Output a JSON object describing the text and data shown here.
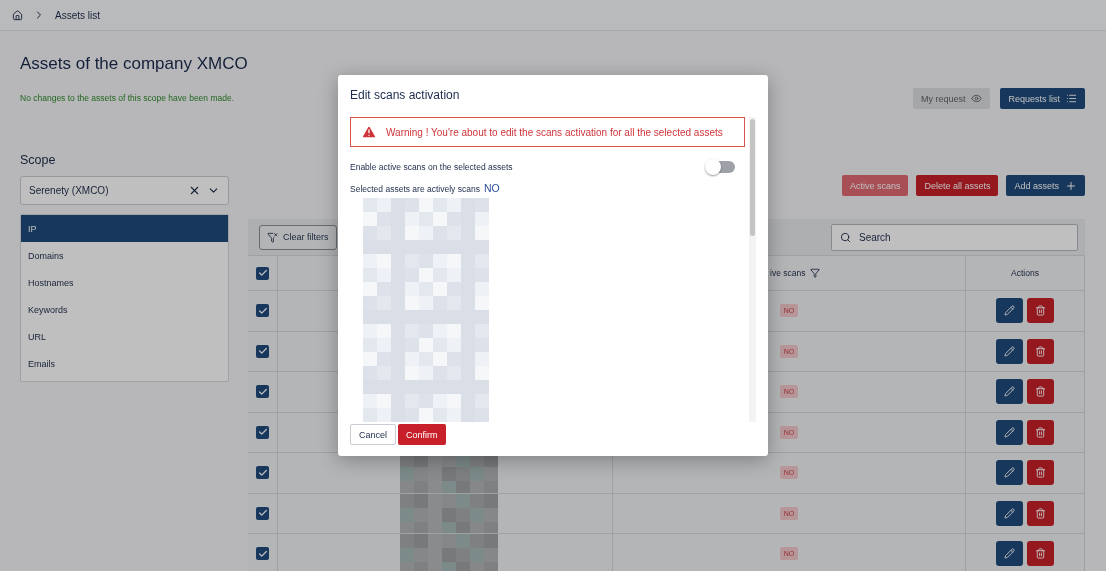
{
  "breadcrumb": {
    "items": [
      "Assets list"
    ]
  },
  "title": "Assets of the company XMCO",
  "status_message": "No changes to the assets of this scope have been made.",
  "header_buttons": [
    {
      "label": "My request",
      "disabled": true
    },
    {
      "label": "Requests list",
      "disabled": false
    }
  ],
  "scope": {
    "label": "Scope",
    "value": "Serenety (XMCO)",
    "categories": [
      {
        "label": "IP",
        "selected": true
      },
      {
        "label": "Domains",
        "selected": false
      },
      {
        "label": "Hostnames",
        "selected": false
      },
      {
        "label": "Keywords",
        "selected": false
      },
      {
        "label": "URL",
        "selected": false
      },
      {
        "label": "Emails",
        "selected": false
      }
    ]
  },
  "actions": [
    {
      "label": "Active scans",
      "kind": "muted"
    },
    {
      "label": "Delete all assets",
      "kind": "danger"
    },
    {
      "label": "Add assets",
      "kind": "primary"
    }
  ],
  "table": {
    "clear_filters": "Clear filters",
    "search": {
      "placeholder": "Search"
    },
    "header_checked": true,
    "columns": [
      {
        "label": "ive scans"
      },
      {
        "label": "Actions"
      }
    ],
    "rows": [
      {
        "checked": true,
        "active_scans": "NO"
      },
      {
        "checked": true,
        "active_scans": "NO"
      },
      {
        "checked": true,
        "active_scans": "NO"
      },
      {
        "checked": true,
        "active_scans": "NO"
      },
      {
        "checked": true,
        "active_scans": "NO",
        "cell_2": {
          "kind": "redacted"
        }
      },
      {
        "checked": true,
        "active_scans": "NO",
        "cell_2": {
          "kind": "redacted"
        }
      },
      {
        "checked": true,
        "active_scans": "NO",
        "cell_2": {
          "kind": "redacted"
        }
      }
    ]
  },
  "modal": {
    "title": "Edit scans activation",
    "warning": "Warning ! You're about to edit the scans activation for all the selected assets",
    "toggle": {
      "label": "Enable active scans on the selected assets",
      "on": false
    },
    "status_label": "Selected assets are actively scans",
    "status_value": "NO",
    "buttons": [
      {
        "label": "Cancel",
        "kind": "secondary"
      },
      {
        "label": "Confirm",
        "kind": "danger"
      }
    ]
  }
}
